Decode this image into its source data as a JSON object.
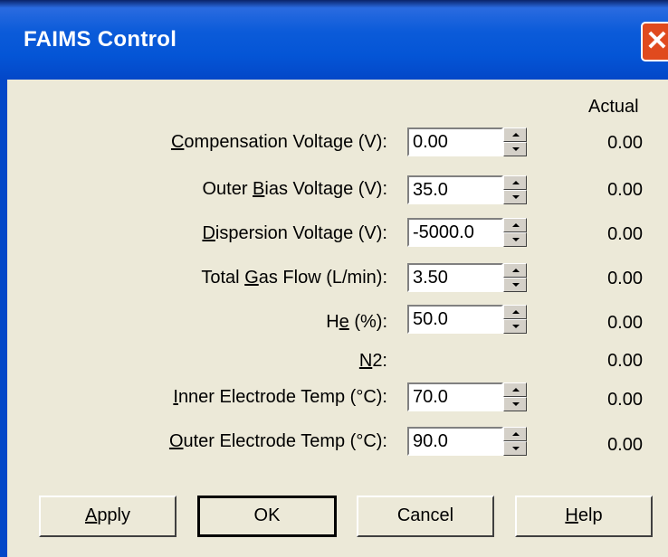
{
  "window": {
    "title": "FAIMS Control",
    "close_glyph": "✕"
  },
  "header": {
    "actual_label": "Actual"
  },
  "rows": [
    {
      "label_pre": "",
      "label_acc": "C",
      "label_post": "ompensation Voltage (V):",
      "value": "0.00",
      "actual": "0.00"
    },
    {
      "label_pre": "Outer ",
      "label_acc": "B",
      "label_post": "ias Voltage (V):",
      "value": "35.0",
      "actual": "0.00"
    },
    {
      "label_pre": "",
      "label_acc": "D",
      "label_post": "ispersion Voltage (V):",
      "value": "-5000.0",
      "actual": "0.00"
    },
    {
      "label_pre": "Total ",
      "label_acc": "G",
      "label_post": "as Flow (L/min):",
      "value": "3.50",
      "actual": "0.00"
    },
    {
      "label_pre": "H",
      "label_acc": "e",
      "label_post": " (%):",
      "value": "50.0",
      "actual": "0.00"
    },
    {
      "label_pre": "",
      "label_acc": "N",
      "label_post": "2:",
      "actual": "0.00"
    },
    {
      "label_pre": "",
      "label_acc": "I",
      "label_post": "nner Electrode Temp (°C):",
      "value": "70.0",
      "actual": "0.00"
    },
    {
      "label_pre": "",
      "label_acc": "O",
      "label_post": "uter Electrode Temp (°C):",
      "value": "90.0",
      "actual": "0.00"
    }
  ],
  "buttons": {
    "apply_acc": "A",
    "apply_rest": "pply",
    "ok": "OK",
    "cancel": "Cancel",
    "help_acc": "H",
    "help_rest": "elp"
  },
  "icons": {
    "close": "close-icon",
    "spin_up": "spin-up-arrow-icon",
    "spin_down": "spin-down-arrow-icon"
  },
  "colors": {
    "titlebar": "#0455D6",
    "close": "#E04A1E",
    "dialog_bg": "#ECE9D8"
  }
}
